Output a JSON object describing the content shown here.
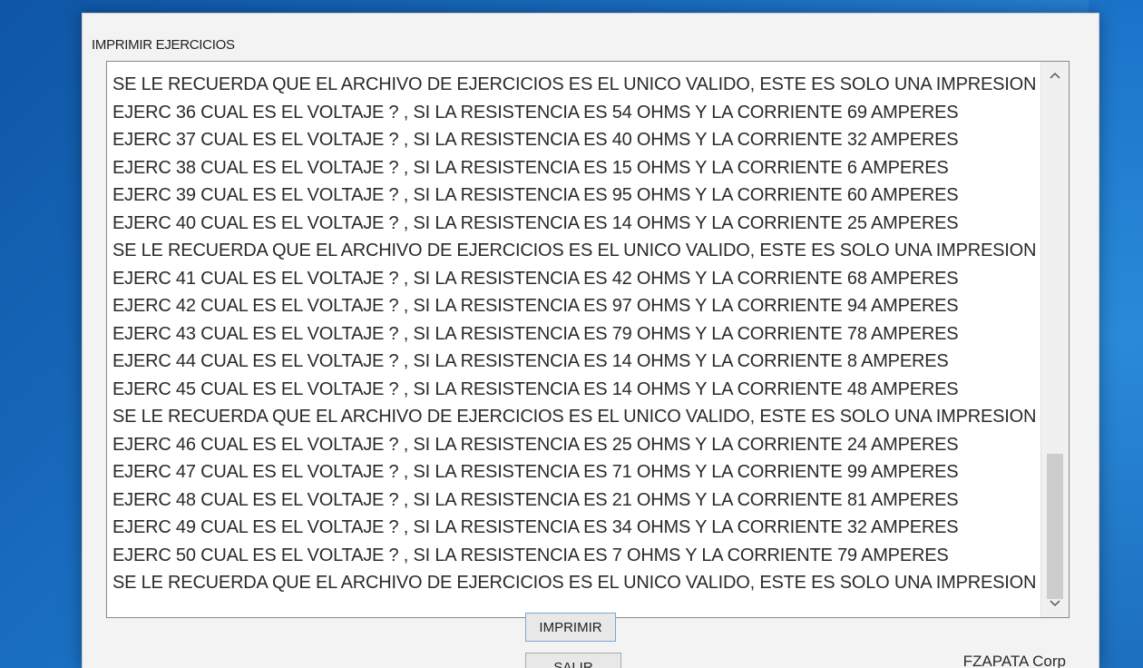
{
  "window": {
    "title": "IMPRIMIR EJERCICIOS"
  },
  "output_lines": [
    "SE LE RECUERDA QUE EL ARCHIVO DE EJERCICIOS ES EL UNICO VALIDO, ESTE ES SOLO UNA IMPRESION",
    "EJERC 36 CUAL ES EL VOLTAJE ? , SI LA RESISTENCIA ES 54 OHMS Y LA CORRIENTE 69 AMPERES",
    "EJERC 37 CUAL ES EL VOLTAJE ? , SI LA RESISTENCIA ES 40 OHMS Y LA CORRIENTE 32 AMPERES",
    "EJERC 38 CUAL ES EL VOLTAJE ? , SI LA RESISTENCIA ES 15 OHMS Y LA CORRIENTE 6 AMPERES",
    "EJERC 39 CUAL ES EL VOLTAJE ? , SI LA RESISTENCIA ES 95 OHMS Y LA CORRIENTE 60 AMPERES",
    "EJERC 40 CUAL ES EL VOLTAJE ? , SI LA RESISTENCIA ES 14 OHMS Y LA CORRIENTE 25 AMPERES",
    "SE LE RECUERDA QUE EL ARCHIVO DE EJERCICIOS ES EL UNICO VALIDO, ESTE ES SOLO UNA IMPRESION",
    "EJERC 41 CUAL ES EL VOLTAJE ? , SI LA RESISTENCIA ES 42 OHMS Y LA CORRIENTE 68 AMPERES",
    "EJERC 42 CUAL ES EL VOLTAJE ? , SI LA RESISTENCIA ES 97 OHMS Y LA CORRIENTE 94 AMPERES",
    "EJERC 43 CUAL ES EL VOLTAJE ? , SI LA RESISTENCIA ES 79 OHMS Y LA CORRIENTE 78 AMPERES",
    "EJERC 44 CUAL ES EL VOLTAJE ? , SI LA RESISTENCIA ES 14 OHMS Y LA CORRIENTE 8 AMPERES",
    "EJERC 45 CUAL ES EL VOLTAJE ? , SI LA RESISTENCIA ES 14 OHMS Y LA CORRIENTE 48 AMPERES",
    "SE LE RECUERDA QUE EL ARCHIVO DE EJERCICIOS ES EL UNICO VALIDO, ESTE ES SOLO UNA IMPRESION",
    "EJERC 46 CUAL ES EL VOLTAJE ? , SI LA RESISTENCIA ES 25 OHMS Y LA CORRIENTE 24 AMPERES",
    "EJERC 47 CUAL ES EL VOLTAJE ? , SI LA RESISTENCIA ES 71 OHMS Y LA CORRIENTE 99 AMPERES",
    "EJERC 48 CUAL ES EL VOLTAJE ? , SI LA RESISTENCIA ES 21 OHMS Y LA CORRIENTE 81 AMPERES",
    "EJERC 49 CUAL ES EL VOLTAJE ? , SI LA RESISTENCIA ES 34 OHMS Y LA CORRIENTE 32 AMPERES",
    "EJERC 50 CUAL ES EL VOLTAJE ? , SI LA RESISTENCIA ES 7 OHMS Y LA CORRIENTE 79 AMPERES",
    "SE LE RECUERDA QUE EL ARCHIVO DE EJERCICIOS ES EL UNICO VALIDO, ESTE ES SOLO UNA IMPRESION"
  ],
  "scrollbar": {
    "up_icon": "chevron-up-icon",
    "down_icon": "chevron-down-icon"
  },
  "buttons": {
    "print_label": "IMPRIMIR",
    "exit_label": "SALIR"
  },
  "footer": {
    "company": "FZAPATA Corp"
  },
  "colors": {
    "desktop": "#1a6fc2",
    "window_bg": "#f3f3f3",
    "text": "#2a2a2a"
  }
}
